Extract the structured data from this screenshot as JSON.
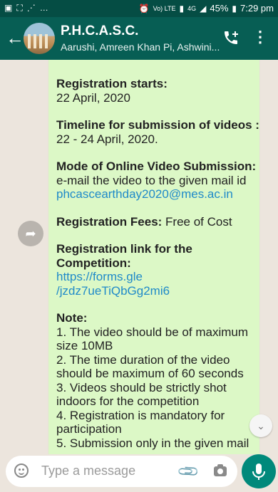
{
  "status_bar": {
    "left_icons": [
      "image-icon",
      "cast-icon",
      "usb-icon",
      "…"
    ],
    "battery": "45%",
    "time": "7:29 pm",
    "network_small": "Vo) LTE",
    "network_gen": "4G"
  },
  "header": {
    "title": "P.H.C.A.S.C.",
    "subtitle": "Aarushi, Amreen Khan Pi, Ashwini...",
    "back_icon": "arrow-left-icon",
    "call_icon": "add-call-icon",
    "menu_icon": "more-vert-icon"
  },
  "message": {
    "reg_start_label": "Registration starts:",
    "reg_start_value": "22 April, 2020",
    "timeline_label": "Timeline for submission of videos :",
    "timeline_value": "22 - 24 April, 2020.",
    "mode_label": "Mode of Online Video Submission:",
    "mode_text": " e-mail the video to the given mail id",
    "email": "phcascearthday2020@mes.ac.in",
    "fees_label": "Registration Fees:",
    "fees_value": " Free of Cost",
    "link_label": "Registration link for the Competition:",
    "link_line1": "https://forms.gle",
    "link_line2": "/jzdz7ueTiQbGg2mi6",
    "note_label": "Note:",
    "notes": [
      "1. The video should be of maximum size 10MB",
      "2. The time duration of the video should be maximum of 60 seconds",
      "3. Videos should be strictly shot indoors for the competition",
      "4. Registration is mandatory for participation",
      "5. Submission only in the given mail"
    ]
  },
  "input": {
    "placeholder": "Type a message"
  },
  "colors": {
    "header": "#075e54",
    "status_bar": "#054d44",
    "bubble": "#dcf8c6",
    "link": "#1f8ac9",
    "mic": "#00897b"
  }
}
